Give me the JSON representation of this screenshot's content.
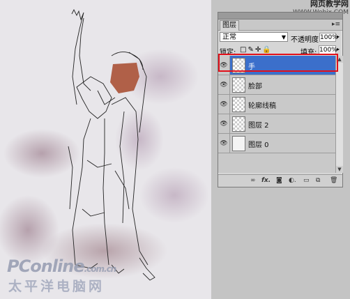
{
  "watermark": {
    "site_cn": "网页教学网",
    "site_url": "WWW.Webjx.COM",
    "pconline": "PConline",
    "pconline_suffix": ".com.cn",
    "pconline_cn": "太平洋电脑网"
  },
  "layers_panel": {
    "tab_label": "图层",
    "menu_icon": "panel-menu-icon",
    "blend_mode": "正常",
    "opacity_label": "不透明度:",
    "opacity_value": "100%",
    "lock_label": "锁定:",
    "fill_label": "填充:",
    "fill_value": "100%",
    "layers": [
      {
        "name": "手",
        "selected": true,
        "thumb": "transparent"
      },
      {
        "name": "脸部",
        "selected": false,
        "thumb": "transparent"
      },
      {
        "name": "轮廓线稿",
        "selected": false,
        "thumb": "transparent"
      },
      {
        "name": "图层 2",
        "selected": false,
        "thumb": "transparent"
      },
      {
        "name": "图层 0",
        "selected": false,
        "thumb": "plain"
      }
    ],
    "bottom_icons": [
      "link-icon",
      "fx-icon",
      "mask-icon",
      "adjustment-icon",
      "group-icon",
      "new-layer-icon",
      "trash-icon"
    ]
  },
  "colors": {
    "selected_layer": "#3b6fcb",
    "highlight_border": "#e2101a",
    "face_fill": "#b06048"
  }
}
